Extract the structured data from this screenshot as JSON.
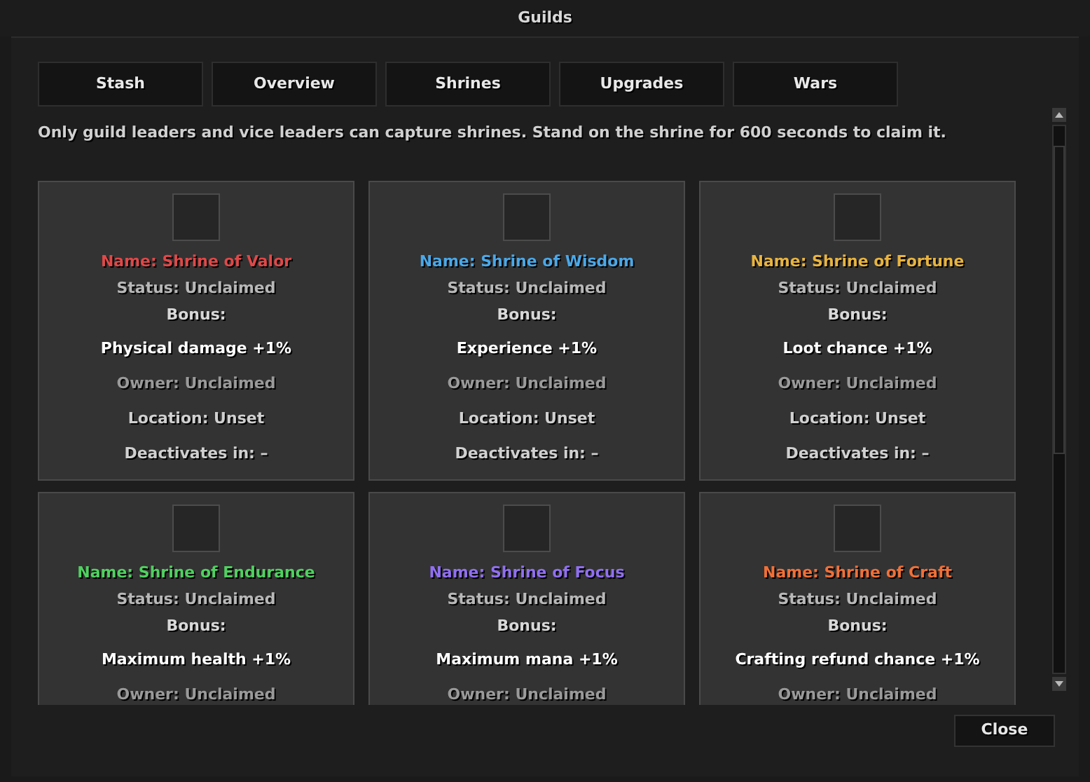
{
  "window": {
    "title": "Guilds"
  },
  "tabs": [
    {
      "label": "Stash"
    },
    {
      "label": "Overview"
    },
    {
      "label": "Shrines"
    },
    {
      "label": "Upgrades"
    },
    {
      "label": "Wars"
    }
  ],
  "notice": "Only guild leaders and vice leaders can capture shrines. Stand on the shrine for 600 seconds to claim it.",
  "shrines": [
    {
      "name": "Name: Shrine of Valor",
      "color": "#e04848",
      "status": "Status: Unclaimed",
      "bonus_label": "Bonus:",
      "bonus": "Physical damage +1%",
      "owner": "Owner: Unclaimed",
      "location": "Location: Unset",
      "deactivates": "Deactivates in: –"
    },
    {
      "name": "Name: Shrine of Wisdom",
      "color": "#4aa8e8",
      "status": "Status: Unclaimed",
      "bonus_label": "Bonus:",
      "bonus": "Experience +1%",
      "owner": "Owner: Unclaimed",
      "location": "Location: Unset",
      "deactivates": "Deactivates in: –"
    },
    {
      "name": "Name: Shrine of Fortune",
      "color": "#e8b440",
      "status": "Status: Unclaimed",
      "bonus_label": "Bonus:",
      "bonus": "Loot chance +1%",
      "owner": "Owner: Unclaimed",
      "location": "Location: Unset",
      "deactivates": "Deactivates in: –"
    },
    {
      "name": "Name: Shrine of Endurance",
      "color": "#50d060",
      "status": "Status: Unclaimed",
      "bonus_label": "Bonus:",
      "bonus": "Maximum health +1%",
      "owner": "Owner: Unclaimed"
    },
    {
      "name": "Name: Shrine of Focus",
      "color": "#9070f0",
      "status": "Status: Unclaimed",
      "bonus_label": "Bonus:",
      "bonus": "Maximum mana +1%",
      "owner": "Owner: Unclaimed"
    },
    {
      "name": "Name: Shrine of Craft",
      "color": "#f07038",
      "status": "Status: Unclaimed",
      "bonus_label": "Bonus:",
      "bonus": "Crafting refund chance +1%",
      "owner": "Owner: Unclaimed"
    }
  ],
  "close_button": "Close"
}
